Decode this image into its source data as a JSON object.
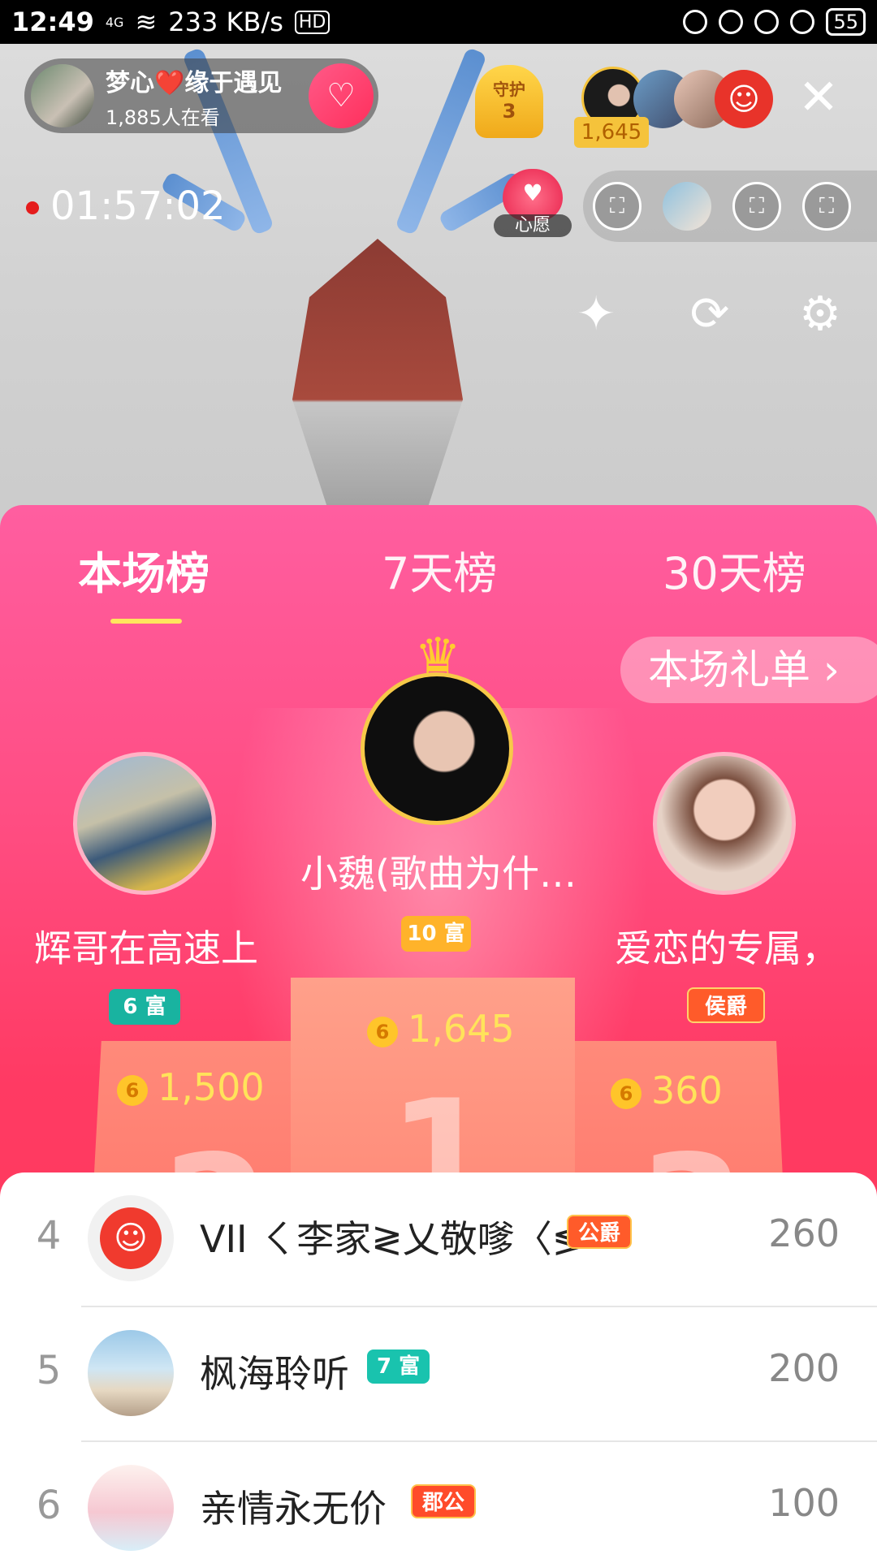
{
  "status_bar": {
    "time": "12:49",
    "network": "4G",
    "speed": "233 KB/s",
    "hd": "HD",
    "battery": "55"
  },
  "host": {
    "name": "梦心❤️缘于遇见",
    "viewers": "1,885人在看"
  },
  "guard": {
    "label": "守护",
    "count": "3"
  },
  "top_viewer": {
    "count": "1,645"
  },
  "live": {
    "timer": "01:57:02"
  },
  "wish": {
    "label": "心愿"
  },
  "tabs": [
    {
      "label": "本场榜",
      "active": true
    },
    {
      "label": "7天榜",
      "active": false
    },
    {
      "label": "30天榜",
      "active": false
    }
  ],
  "gift_list_button": "本场礼单 ›",
  "podium": {
    "first": {
      "name": "小魏(歌曲为什…",
      "badge": "10 富",
      "score": "1,645"
    },
    "second": {
      "name": "辉哥在高速上",
      "badge": "6 富",
      "score": "1,500"
    },
    "third": {
      "name": "爱恋的专属，",
      "badge": "侯爵",
      "score": "360"
    },
    "coin_glyph": "6"
  },
  "ranking_list": [
    {
      "rank": "4",
      "name": "VII ㄑ李家≷乂敬嗲〈≶",
      "badge": "公爵",
      "score": "260"
    },
    {
      "rank": "5",
      "name": "枫海聆听",
      "badge": "7 富",
      "score": "200"
    },
    {
      "rank": "6",
      "name": "亲情永无价",
      "badge": "郡公",
      "score": "100"
    }
  ],
  "colors": {
    "panel_top": "#ff5ea0",
    "panel_bottom": "#ff3a55",
    "score_yellow": "#ffe35a",
    "wealth_teal": "#19b3a0",
    "noble_orange": "#ff5b2a"
  },
  "icons": {
    "follow": "heart-plus-icon",
    "close": "close-icon",
    "beauty": "magic-wand-icon",
    "camera": "camera-switch-icon",
    "settings": "gear-icon",
    "seat": "sofa-icon",
    "crown": "crown-icon",
    "coin": "coin-icon"
  }
}
